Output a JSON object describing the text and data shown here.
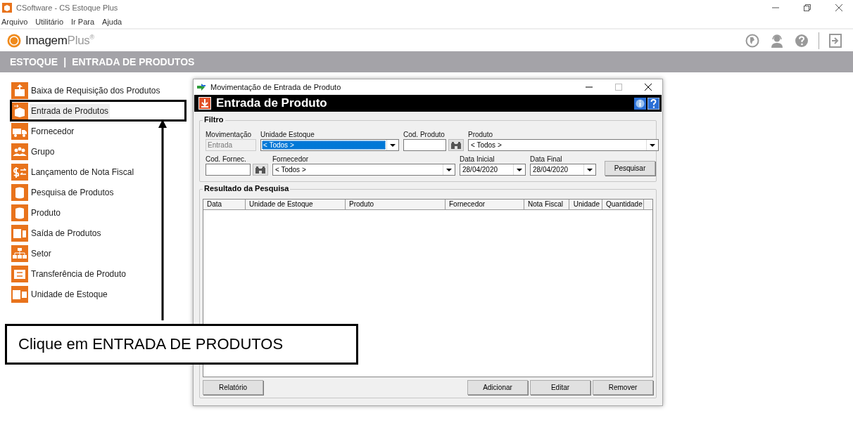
{
  "window": {
    "title": "CSoftware - CS Estoque Plus"
  },
  "menu": [
    "Arquivo",
    "Utilitário",
    "Ir Para",
    "Ajuda"
  ],
  "brand": {
    "name": "Imagem",
    "accent": "Plus$^{®}$"
  },
  "breadcrumb": {
    "section": "ESTOQUE",
    "separator": "|",
    "page": "ENTRADA DE PRODUTOS"
  },
  "sidebar": {
    "items": [
      {
        "label": "Baixa de Requisição dos Produtos",
        "kind": "upload",
        "selected": false,
        "outlined": false
      },
      {
        "label": "Entrada de Produtos",
        "kind": "box",
        "selected": true,
        "outlined": true
      },
      {
        "label": "Fornecedor",
        "kind": "truck",
        "selected": false,
        "outlined": false
      },
      {
        "label": "Grupo",
        "kind": "group",
        "selected": false,
        "outlined": false
      },
      {
        "label": "Lançamento de Nota Fiscal",
        "kind": "money",
        "selected": false,
        "outlined": false
      },
      {
        "label": "Pesquisa de Produtos",
        "kind": "cylinder",
        "selected": false,
        "outlined": false
      },
      {
        "label": "Produto",
        "kind": "cylinder",
        "selected": false,
        "outlined": false
      },
      {
        "label": "Saída de Produtos",
        "kind": "exit",
        "selected": false,
        "outlined": false
      },
      {
        "label": "Setor",
        "kind": "tree",
        "selected": false,
        "outlined": false
      },
      {
        "label": "Transferência de Produto",
        "kind": "transfer",
        "selected": false,
        "outlined": false
      },
      {
        "label": "Unidade de Estoque",
        "kind": "units",
        "selected": false,
        "outlined": false
      }
    ]
  },
  "dialog": {
    "title": "Movimentação de Entrada de Produto",
    "header": "Entrada de Produto",
    "filter": {
      "legend": "Filtro",
      "upper_fields": [
        {
          "kind": "text",
          "label": "Movimentação",
          "value": "Entrada",
          "disabled": true
        },
        {
          "kind": "combo",
          "label": "Unidade Estoque",
          "value": "< Todos >",
          "selected": true
        },
        {
          "kind": "lookup",
          "label": "Cod. Produto"
        },
        {
          "kind": "combo",
          "label": "Produto",
          "value": "< Todos >",
          "selected": false
        }
      ],
      "lower_fields": [
        {
          "kind": "lookup",
          "label": "Cod. Fornec."
        },
        {
          "kind": "combo",
          "label": "Fornecedor",
          "value": "< Todos >",
          "selected": false
        },
        {
          "kind": "combo",
          "label": "Data Inicial",
          "value": "28/04/2020",
          "selected": false
        },
        {
          "kind": "combo",
          "label": "Data Final",
          "value": "28/04/2020",
          "selected": false
        },
        {
          "kind": "button",
          "label": "Pesquisar"
        }
      ]
    },
    "results": {
      "legend": "Resultado da Pesquisa",
      "columns": [
        "Data",
        "Unidade de Estoque",
        "Produto",
        "Fornecedor",
        "Nota Fiscal",
        "Unidade",
        "Quantidade"
      ]
    },
    "left_buttons": [
      "Relatório"
    ],
    "right_buttons": [
      "Adicionar",
      "Editar",
      "Remover"
    ]
  },
  "annotation": {
    "text": "Clique em ENTRADA DE PRODUTOS"
  }
}
